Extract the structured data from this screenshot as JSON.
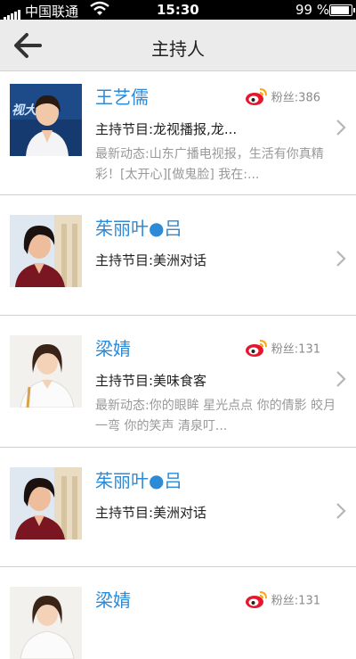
{
  "status_bar": {
    "carrier": "中国联通",
    "time": "15:30",
    "battery": "99 %"
  },
  "nav": {
    "back_icon": "back-arrow-icon",
    "title": "主持人"
  },
  "colors": {
    "name_blue": "#2d8ad6",
    "weibo_red": "#e6162d",
    "weibo_yellow": "#f5a623"
  },
  "hosts": [
    {
      "name": "王艺儒",
      "fans": "粉丝:386",
      "program": "主持节目:龙视播报,龙...",
      "news": "最新动态:山东广播电视报，生活有你真精彩！[太开心][做鬼脸] 我在:..."
    },
    {
      "name": "茱丽叶●吕",
      "fans": "",
      "program": "主持节目:美洲对话",
      "news": ""
    },
    {
      "name": "梁婧",
      "fans": "粉丝:131",
      "program": "主持节目:美味食客",
      "news": "最新动态:你的眼眸 星光点点 你的倩影 皎月一弯 你的笑声 清泉叮..."
    },
    {
      "name": "茱丽叶●吕",
      "fans": "",
      "program": "主持节目:美洲对话",
      "news": ""
    },
    {
      "name": "梁婧",
      "fans": "粉丝:131",
      "program": "",
      "news": ""
    }
  ]
}
